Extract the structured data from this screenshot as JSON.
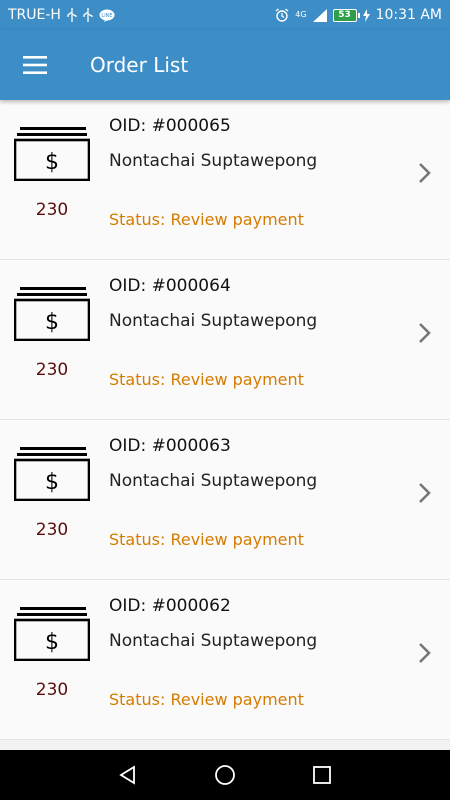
{
  "status_bar": {
    "carrier": "TRUE-H",
    "network": "4G",
    "battery": "53",
    "time": "10:31 AM",
    "icons": [
      "usb-icon",
      "usb-icon",
      "line-chat-icon",
      "alarm-icon",
      "signal-icon",
      "battery-icon",
      "charging-icon"
    ]
  },
  "app_bar": {
    "title": "Order List",
    "menu_icon": "hamburger-menu-icon"
  },
  "orders": [
    {
      "oid": "OID: #000065",
      "customer": "Nontachai Suptawepong",
      "amount": "230",
      "status": "Status: Review payment"
    },
    {
      "oid": "OID: #000064",
      "customer": "Nontachai Suptawepong",
      "amount": "230",
      "status": "Status: Review payment"
    },
    {
      "oid": "OID: #000063",
      "customer": "Nontachai Suptawepong",
      "amount": "230",
      "status": "Status: Review payment"
    },
    {
      "oid": "OID: #000062",
      "customer": "Nontachai Suptawepong",
      "amount": "230",
      "status": "Status: Review payment"
    }
  ],
  "colors": {
    "app_bar": "#3d8dc7",
    "status_text": "#d47b00",
    "amount_text": "#5a0f0f"
  },
  "nav_bar": {
    "icons": [
      "back-triangle-icon",
      "home-circle-icon",
      "recents-square-icon"
    ]
  }
}
